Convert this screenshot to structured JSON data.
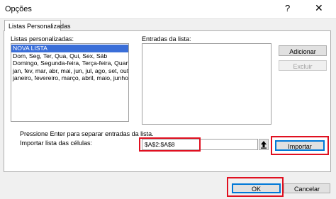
{
  "window": {
    "title": "Opções",
    "help_glyph": "?",
    "close_glyph": "✕"
  },
  "tab": {
    "label": "Listas Personalizadas"
  },
  "custom_lists": {
    "label": "Listas personalizadas:",
    "items": [
      "NOVA LISTA",
      "Dom, Seg, Ter, Qua, Qui, Sex, Sáb",
      "Domingo, Segunda-feira, Terça-feira, Quarta-feira",
      "jan, fev, mar, abr, mai, jun, jul, ago, set, out, nov, d",
      "janeiro, fevereiro, março, abril, maio, junho, julho, ("
    ],
    "selected_index": 0
  },
  "entries": {
    "label": "Entradas da lista:"
  },
  "buttons": {
    "add": "Adicionar",
    "delete": "Excluir",
    "import": "Importar",
    "ok": "OK",
    "cancel": "Cancelar"
  },
  "hint": "Pressione Enter para separar entradas da lista.",
  "import_label": "Importar lista das células:",
  "import_range": {
    "value": "$A$2:$A$8"
  },
  "icons": {
    "collapse": "collapse-dialog-icon"
  },
  "colors": {
    "highlight_red": "#e01020",
    "selection": "#3a6ed8",
    "focus": "#0078d7"
  }
}
